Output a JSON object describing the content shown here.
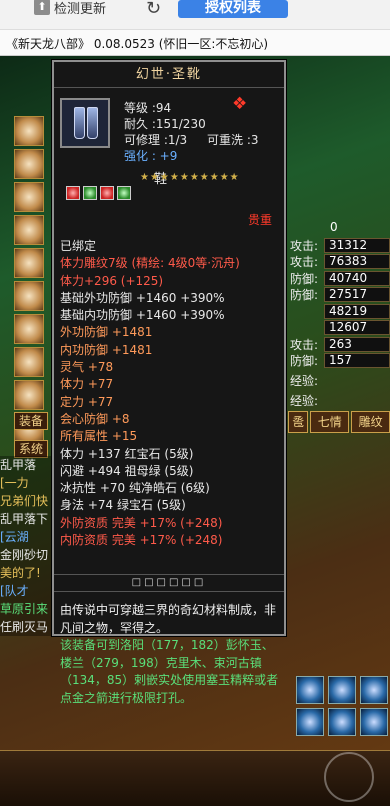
{
  "topbar": {
    "check_update_label": "检测更新",
    "auth_list_label": "授权列表"
  },
  "window": {
    "title": "《新天龙八部》 0.08.0523 (怀旧一区:不忘初心)"
  },
  "left_buttons": {
    "equip_label": "装备",
    "system_label": "系统"
  },
  "chat": {
    "lines": [
      "乱甲落",
      "[一力",
      "兄弟们快",
      "乱甲落下",
      "[云湖",
      "金刚砂切",
      "美的了!",
      "[队才",
      "草原引来",
      "任刷灭马"
    ]
  },
  "right_panel": {
    "rows": [
      {
        "label": "攻击:",
        "value": "31312"
      },
      {
        "label": "攻击:",
        "value": "76383"
      },
      {
        "label": "防御:",
        "value": "40740"
      },
      {
        "label": "防御:",
        "value": "27517"
      },
      {
        "label": "",
        "value": "48219"
      },
      {
        "label": "",
        "value": "12607"
      },
      {
        "label": "攻击:",
        "value": "263"
      },
      {
        "label": "防御:",
        "value": "157"
      }
    ],
    "zero_value": "0",
    "exp_label_1": "经验:",
    "exp_label_2": "经验:",
    "tab_1": "卺",
    "tab_2": "七情",
    "tab_3": "雕纹"
  },
  "tooltip": {
    "name": "幻世·圣靴",
    "level": "等级 :94",
    "durability": "耐久 :151/230",
    "repair": "可修理 :1/3",
    "rewash": "可重洗 :3",
    "enhance": "强化 : +9",
    "slot": "鞋",
    "valued": "贵重",
    "bound": "已绑定",
    "carving": "体力雕纹7级 (精绘: 4级0等·沉舟)",
    "props": [
      {
        "text": "体力+296 (+125)",
        "color": "red"
      },
      {
        "text": "基础外功防御 +1460 +390%",
        "color": "white"
      },
      {
        "text": "基础内功防御 +1460 +390%",
        "color": "white"
      },
      {
        "text": "外功防御 +1481",
        "color": "orange"
      },
      {
        "text": "内功防御 +1481",
        "color": "orange"
      },
      {
        "text": "灵气 +78",
        "color": "orange"
      },
      {
        "text": "体力 +77",
        "color": "orange"
      },
      {
        "text": "定力 +77",
        "color": "orange"
      },
      {
        "text": "会心防御 +8",
        "color": "orange"
      },
      {
        "text": "所有属性 +15",
        "color": "orange"
      },
      {
        "text": "体力 +137 红宝石 (5级)",
        "color": "white"
      },
      {
        "text": "闪避 +494 祖母绿 (5级)",
        "color": "white"
      },
      {
        "text": "冰抗性 +70 纯净皓石 (6级)",
        "color": "white"
      },
      {
        "text": "身法 +74 绿宝石 (5级)",
        "color": "white"
      },
      {
        "text": "外防资质   完美 +17% (+248)",
        "color": "red"
      },
      {
        "text": "内防资质   完美 +17% (+248)",
        "color": "red"
      }
    ],
    "boxes": "□□□□□□",
    "desc_white": "由传说中可穿越三界的奇幻材料制成，非凡间之物，罕得之。",
    "desc_green": "该装备可到洛阳（177，182）彭怀玉、楼兰（279，198）克里木、束河古镇（134，85）剌嵌实处使用塞玉精粹或者点金之箭进行极限打孔。"
  }
}
